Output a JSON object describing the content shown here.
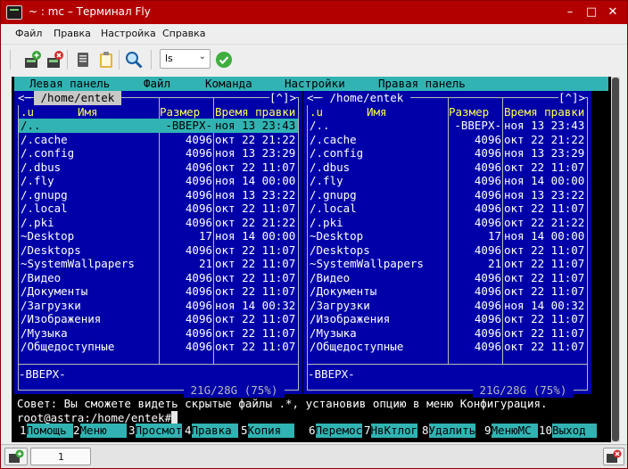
{
  "window": {
    "title": "~ : mc – Терминал Fly",
    "buttons": [
      "–",
      "□",
      "✕"
    ]
  },
  "menubar": [
    "Файл",
    "Правка",
    "Настройка",
    "Справка"
  ],
  "toolbar": {
    "icons": [
      "new-tab-icon",
      "close-tab-icon",
      "copy-icon",
      "paste-icon",
      "find-icon"
    ],
    "command_combo": "ls",
    "run_icon": "run-check-icon"
  },
  "mc": {
    "menu": [
      "Левая панель",
      "Файл",
      "Команда",
      "Настройки",
      "Правая панель"
    ],
    "left": {
      "path": " /home/entek ",
      "corner": "[^]>",
      "columns": {
        "name_col": ".u",
        "name": "Имя",
        "size": "Размер",
        "time": "Время правки"
      },
      "rows": [
        {
          "name": "/..",
          "size": "-ВВЕРХ-",
          "time": "ноя 13 23:43"
        },
        {
          "name": "/.cache",
          "size": "4096",
          "time": "окт 22 21:22"
        },
        {
          "name": "/.config",
          "size": "4096",
          "time": "ноя 13 23:29"
        },
        {
          "name": "/.dbus",
          "size": "4096",
          "time": "окт 22 11:07"
        },
        {
          "name": "/.fly",
          "size": "4096",
          "time": "ноя 14 00:00"
        },
        {
          "name": "/.gnupg",
          "size": "4096",
          "time": "ноя 13 23:22"
        },
        {
          "name": "/.local",
          "size": "4096",
          "time": "окт 22 11:07"
        },
        {
          "name": "/.pki",
          "size": "4096",
          "time": "окт 22 21:22"
        },
        {
          "name": "~Desktop",
          "size": "17",
          "time": "ноя 14 00:00"
        },
        {
          "name": "/Desktops",
          "size": "4096",
          "time": "окт 22 11:07"
        },
        {
          "name": "~SystemWallpapers",
          "size": "21",
          "time": "окт 22 11:07"
        },
        {
          "name": "/Видео",
          "size": "4096",
          "time": "окт 22 11:07"
        },
        {
          "name": "/Документы",
          "size": "4096",
          "time": "окт 22 11:07"
        },
        {
          "name": "/Загрузки",
          "size": "4096",
          "time": "ноя 14 00:32"
        },
        {
          "name": "/Изображения",
          "size": "4096",
          "time": "окт 22 11:07"
        },
        {
          "name": "/Музыка",
          "size": "4096",
          "time": "окт 22 11:07"
        },
        {
          "name": "/Общедоступные",
          "size": "4096",
          "time": "окт 22 11:07"
        }
      ],
      "mini_status": "-ВВЕРХ-",
      "disk": " 21G/28G (75%) "
    },
    "right": {
      "path": " /home/entek ",
      "corner": "[^]>",
      "columns": {
        "name_col": ".u",
        "name": "Имя",
        "size": "Размер",
        "time": "Время правки"
      },
      "rows": [
        {
          "name": "/..",
          "size": "-ВВЕРХ-",
          "time": "ноя 13 23:43"
        },
        {
          "name": "/.cache",
          "size": "4096",
          "time": "окт 22 21:22"
        },
        {
          "name": "/.config",
          "size": "4096",
          "time": "ноя 13 23:29"
        },
        {
          "name": "/.dbus",
          "size": "4096",
          "time": "окт 22 11:07"
        },
        {
          "name": "/.fly",
          "size": "4096",
          "time": "ноя 14 00:00"
        },
        {
          "name": "/.gnupg",
          "size": "4096",
          "time": "ноя 13 23:22"
        },
        {
          "name": "/.local",
          "size": "4096",
          "time": "окт 22 11:07"
        },
        {
          "name": "/.pki",
          "size": "4096",
          "time": "окт 22 21:22"
        },
        {
          "name": "~Desktop",
          "size": "17",
          "time": "ноя 14 00:00"
        },
        {
          "name": "/Desktops",
          "size": "4096",
          "time": "окт 22 11:07"
        },
        {
          "name": "~SystemWallpapers",
          "size": "21",
          "time": "окт 22 11:07"
        },
        {
          "name": "/Видео",
          "size": "4096",
          "time": "окт 22 11:07"
        },
        {
          "name": "/Документы",
          "size": "4096",
          "time": "окт 22 11:07"
        },
        {
          "name": "/Загрузки",
          "size": "4096",
          "time": "ноя 14 00:32"
        },
        {
          "name": "/Изображения",
          "size": "4096",
          "time": "окт 22 11:07"
        },
        {
          "name": "/Музыка",
          "size": "4096",
          "time": "окт 22 11:07"
        },
        {
          "name": "/Общедоступные",
          "size": "4096",
          "time": "окт 22 11:07"
        }
      ],
      "mini_status": "-ВВЕРХ-",
      "disk": " 21G/28G (75%) "
    },
    "hint": "Совет: Вы сможете видеть скрытые файлы .*, установив опцию в меню Конфигурация.",
    "prompt": "root@astra:/home/entek#",
    "fkeys": [
      {
        "n": "1",
        "label": "Помощь"
      },
      {
        "n": "2",
        "label": "Меню"
      },
      {
        "n": "3",
        "label": "Просмотр"
      },
      {
        "n": "4",
        "label": "Правка"
      },
      {
        "n": "5",
        "label": "Копия"
      },
      {
        "n": "6",
        "label": "Перемос"
      },
      {
        "n": "7",
        "label": "НвКтлог"
      },
      {
        "n": "8",
        "label": "Удалить"
      },
      {
        "n": "9",
        "label": "МенюМС"
      },
      {
        "n": "10",
        "label": "Выход"
      }
    ]
  },
  "taskbar": {
    "tab_number": "1"
  },
  "colors": {
    "title_red": "#b20000",
    "mc_blue": "#0000a8",
    "mc_cyan": "#31b3b3",
    "mc_yellow": "#ffff54"
  }
}
